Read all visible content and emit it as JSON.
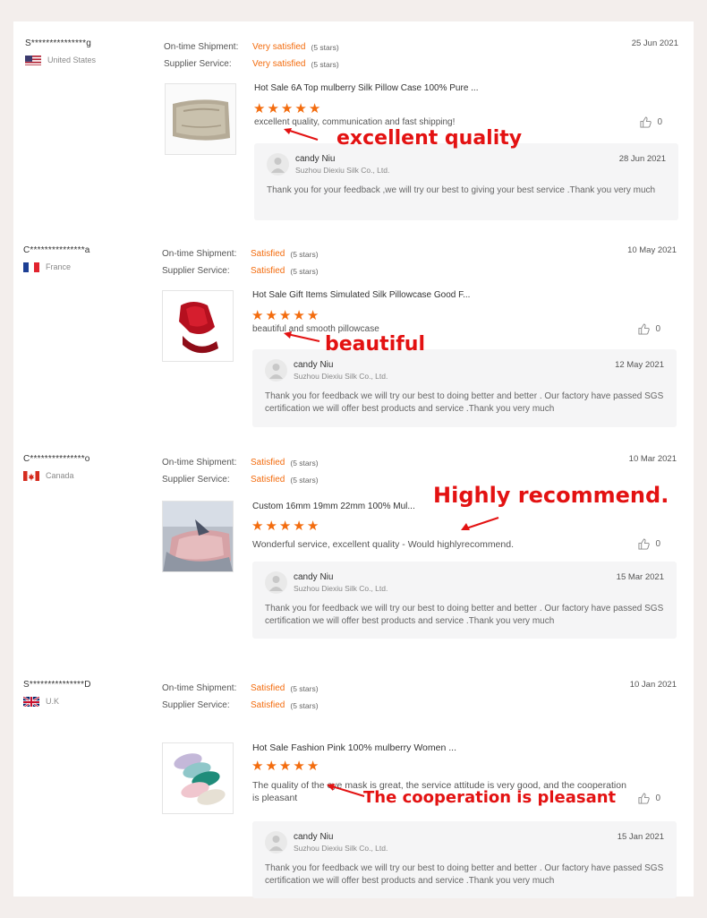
{
  "labels": {
    "shipment": "On-time Shipment:",
    "service": "Supplier Service:"
  },
  "reviews": [
    {
      "buyer": "S***************g",
      "country": "United States",
      "flag": "us-flag",
      "shipment_value": "Very satisfied",
      "shipment_stars": "(5 stars)",
      "service_value": "Very satisfied",
      "service_stars": "(5 stars)",
      "date": "25 Jun 2021",
      "product_title": "Hot Sale 6A Top mulberry Silk Pillow Case 100% Pure ...",
      "rating": 5,
      "feedback": "excellent quality, communication and fast shipping!",
      "likes": "0",
      "reply": {
        "name": "candy Niu",
        "company": "Suzhou Diexiu Silk Co., Ltd.",
        "date": "28 Jun 2021",
        "text": "Thank you for your feedback ,we will try our best to giving your best service .Thank you very much"
      },
      "annotation": "excellent quality"
    },
    {
      "buyer": "C***************a",
      "country": "France",
      "flag": "fr-flag",
      "shipment_value": "Satisfied",
      "shipment_stars": "(5 stars)",
      "service_value": "Satisfied",
      "service_stars": "(5 stars)",
      "date": "10 May 2021",
      "product_title": "Hot Sale Gift Items Simulated Silk Pillowcase Good F...",
      "rating": 5,
      "feedback": "beautiful and smooth pillowcase",
      "likes": "0",
      "reply": {
        "name": "candy Niu",
        "company": "Suzhou Diexiu Silk Co., Ltd.",
        "date": "12 May 2021",
        "text": "Thank you for feedback we will try our best to doing better and better . Our factory have passed SGS certification we will offer best products and service .Thank you very much"
      },
      "annotation": "beautiful"
    },
    {
      "buyer": "C***************o",
      "country": "Canada",
      "flag": "ca-flag",
      "shipment_value": "Satisfied",
      "shipment_stars": "(5 stars)",
      "service_value": "Satisfied",
      "service_stars": "(5 stars)",
      "date": "10 Mar 2021",
      "product_title": "Custom 16mm 19mm 22mm 100% Mul...",
      "rating": 5,
      "feedback": "Wonderful service, excellent quality -  Would highlyrecommend.",
      "likes": "0",
      "reply": {
        "name": "candy Niu",
        "company": "Suzhou Diexiu Silk Co., Ltd.",
        "date": "15 Mar 2021",
        "text": "Thank you for feedback we will try our best to doing better and better . Our factory have passed SGS certification we will offer best products and service .Thank you very much"
      },
      "annotation": "Highly recommend."
    },
    {
      "buyer": "S***************D",
      "country": "U.K",
      "flag": "uk-flag",
      "shipment_value": "Satisfied",
      "shipment_stars": "(5 stars)",
      "service_value": "Satisfied",
      "service_stars": "(5 stars)",
      "date": "10 Jan 2021",
      "product_title": "Hot Sale Fashion Pink 100% mulberry Women  ...",
      "rating": 5,
      "feedback": "The quality of the eye mask is great, the service attitude is very good, and the cooperation is pleasant",
      "likes": "0",
      "reply": {
        "name": "candy Niu",
        "company": "Suzhou Diexiu Silk Co., Ltd.",
        "date": "15 Jan 2021",
        "text": "Thank you for feedback we will try our best to doing better and better . Our factory have passed SGS certification we will offer best products and service .Thank you very much"
      },
      "annotation": "The cooperation is pleasant"
    }
  ],
  "colors": {
    "accent": "#f36c0e",
    "annotation": "#e31212",
    "reply_bg": "#f5f5f6",
    "page_bg": "#f3eeec"
  },
  "icons": {
    "star": "star-icon",
    "like": "thumbs-up-icon"
  }
}
